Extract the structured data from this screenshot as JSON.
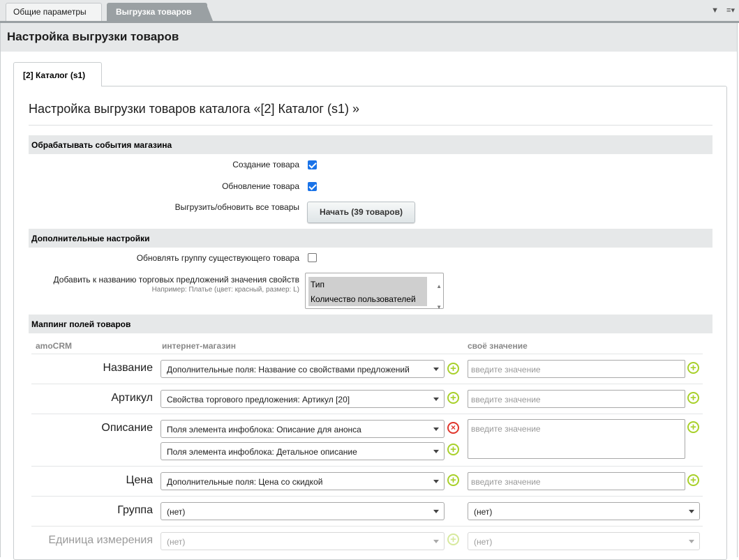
{
  "top_tabs": [
    "Общие параметры",
    "Выгрузка товаров"
  ],
  "page_title": "Настройка выгрузки товаров",
  "inner_tab": "[2] Каталог (s1)",
  "panel_title": "Настройка выгрузки товаров каталога «[2] Каталог (s1) »",
  "sections": {
    "events": "Обрабатывать события магазина",
    "extra": "Дополнительные настройки",
    "mapping": "Маппинг полей товаров"
  },
  "events": {
    "create_label": "Создание товара",
    "create_checked": true,
    "update_label": "Обновление товара",
    "update_checked": true,
    "export_label": "Выгрузить/обновить все товары",
    "start_button": "Начать (39 товаров)"
  },
  "extra": {
    "group_label": "Обновлять группу существующего товара",
    "group_checked": false,
    "props_label": "Добавить к названию торговых предложений значения свойств",
    "props_hint": "Например: Платье (цвет: красный, размер: L)",
    "props_options": [
      "Тип",
      "Количество пользователей"
    ]
  },
  "mapping": {
    "col_amocrm": "amoCRM",
    "col_shop": "интернет-магазин",
    "col_own": "своё значение",
    "placeholder": "введите значение",
    "rows": [
      {
        "name": "Название",
        "selects": [
          "Дополнительные поля: Название со свойствами предложений"
        ]
      },
      {
        "name": "Артикул",
        "selects": [
          "Свойства торгового предложения: Артикул [20]"
        ]
      },
      {
        "name": "Описание",
        "selects": [
          "Поля элемента инфоблока: Описание для анонса",
          "Поля элемента инфоблока: Детальное описание"
        ]
      },
      {
        "name": "Цена",
        "selects": [
          "Дополнительные поля: Цена со скидкой"
        ]
      },
      {
        "name": "Группа",
        "selects": [
          "(нет)"
        ],
        "own_select": "(нет)"
      },
      {
        "name": "Единица измерения",
        "selects": [
          "(нет)"
        ],
        "own_select": "(нет)"
      }
    ]
  },
  "colors": {
    "accent_green": "#a8d02a",
    "remove_red": "#e0352b",
    "check_blue": "#1a73e8"
  }
}
